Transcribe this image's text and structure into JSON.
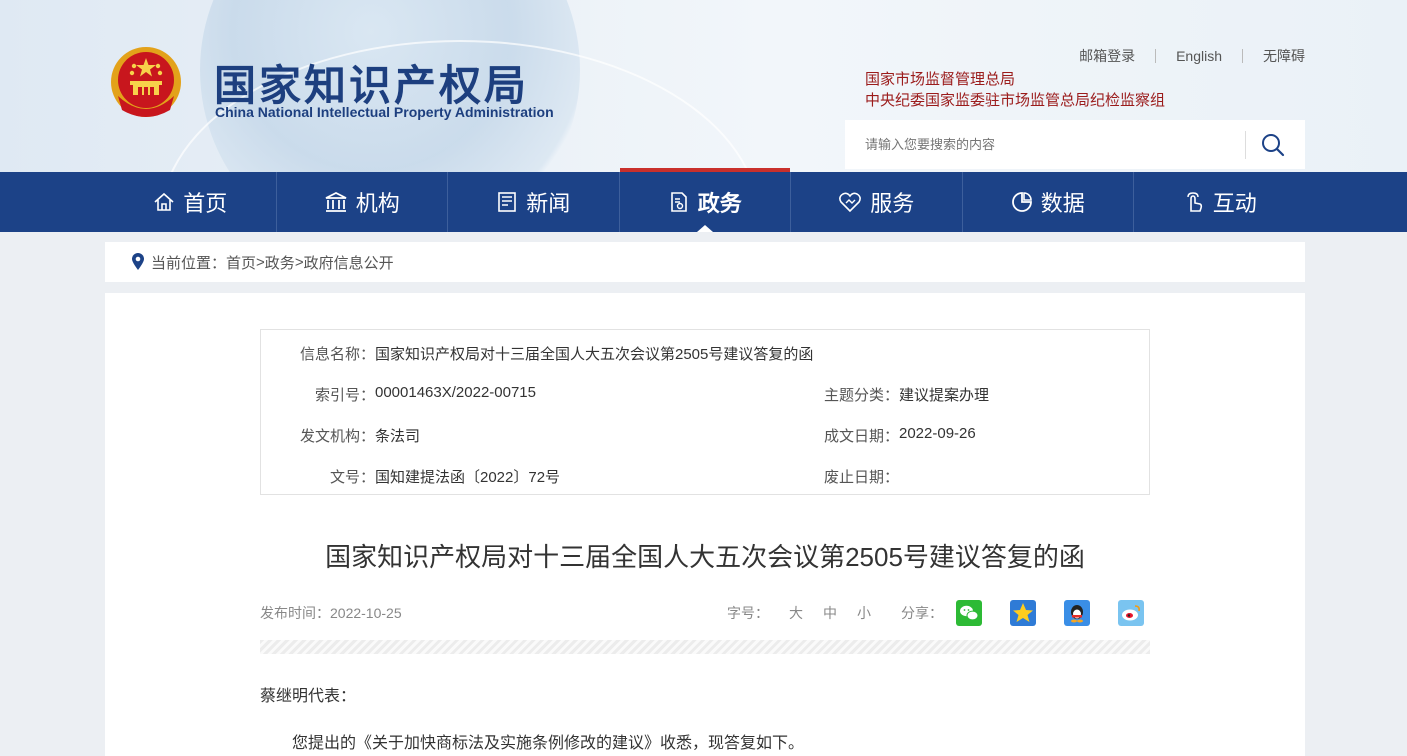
{
  "header": {
    "logo_cn": "国家知识产权局",
    "logo_en": "China National Intellectual Property Administration",
    "top_links": [
      "邮箱登录",
      "English",
      "无障碍"
    ],
    "sup_links": [
      "国家市场监督管理总局",
      "中央纪委国家监委驻市场监管总局纪检监察组"
    ],
    "search_placeholder": "请输入您要搜索的内容"
  },
  "nav": {
    "items": [
      {
        "label": "首页",
        "icon": "home-icon"
      },
      {
        "label": "机构",
        "icon": "institution-icon"
      },
      {
        "label": "新闻",
        "icon": "news-icon"
      },
      {
        "label": "政务",
        "icon": "government-affairs-icon",
        "active": true
      },
      {
        "label": "服务",
        "icon": "service-icon"
      },
      {
        "label": "数据",
        "icon": "data-icon"
      },
      {
        "label": "互动",
        "icon": "interaction-icon"
      }
    ],
    "accent": "#c9302c",
    "bg": "#1c4287"
  },
  "breadcrumb": {
    "prefix": "当前位置：",
    "items": [
      "首页",
      "政务",
      "政府信息公开"
    ],
    "sep": ">"
  },
  "meta": {
    "name_label": "信息名称：",
    "name_value": "国家知识产权局对十三届全国人大五次会议第2505号建议答复的函",
    "index_label": "索引号：",
    "index_value": "00001463X/2022-00715",
    "topic_label": "主题分类：",
    "topic_value": "建议提案办理",
    "issuer_label": "发文机构：",
    "issuer_value": "条法司",
    "date_label": "成文日期：",
    "date_value": "2022-09-26",
    "docno_label": "文号：",
    "docno_value": "国知建提法函〔2022〕72号",
    "abolish_label": "废止日期：",
    "abolish_value": ""
  },
  "article": {
    "title": "国家知识产权局对十三届全国人大五次会议第2505号建议答复的函",
    "publish": "发布时间：2022-10-25",
    "fontsize_label": "字号：",
    "fontsizes": [
      "大",
      "中",
      "小"
    ],
    "share_label": "分享：",
    "share_icons": [
      "wechat-icon",
      "qzone-icon",
      "qq-icon",
      "weibo-icon"
    ],
    "salutation": "蔡继明代表：",
    "para1": "您提出的《关于加快商标法及实施条例修改的建议》收悉，现答复如下。"
  }
}
